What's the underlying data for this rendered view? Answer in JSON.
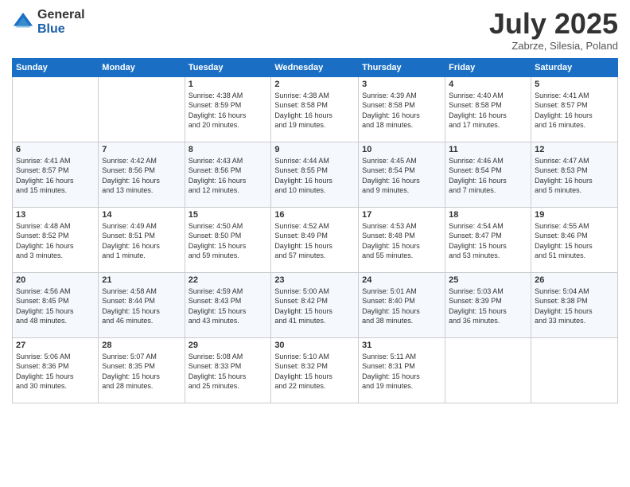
{
  "logo": {
    "general": "General",
    "blue": "Blue"
  },
  "title": "July 2025",
  "subtitle": "Zabrze, Silesia, Poland",
  "headers": [
    "Sunday",
    "Monday",
    "Tuesday",
    "Wednesday",
    "Thursday",
    "Friday",
    "Saturday"
  ],
  "weeks": [
    [
      {
        "day": "",
        "info": ""
      },
      {
        "day": "",
        "info": ""
      },
      {
        "day": "1",
        "info": "Sunrise: 4:38 AM\nSunset: 8:59 PM\nDaylight: 16 hours\nand 20 minutes."
      },
      {
        "day": "2",
        "info": "Sunrise: 4:38 AM\nSunset: 8:58 PM\nDaylight: 16 hours\nand 19 minutes."
      },
      {
        "day": "3",
        "info": "Sunrise: 4:39 AM\nSunset: 8:58 PM\nDaylight: 16 hours\nand 18 minutes."
      },
      {
        "day": "4",
        "info": "Sunrise: 4:40 AM\nSunset: 8:58 PM\nDaylight: 16 hours\nand 17 minutes."
      },
      {
        "day": "5",
        "info": "Sunrise: 4:41 AM\nSunset: 8:57 PM\nDaylight: 16 hours\nand 16 minutes."
      }
    ],
    [
      {
        "day": "6",
        "info": "Sunrise: 4:41 AM\nSunset: 8:57 PM\nDaylight: 16 hours\nand 15 minutes."
      },
      {
        "day": "7",
        "info": "Sunrise: 4:42 AM\nSunset: 8:56 PM\nDaylight: 16 hours\nand 13 minutes."
      },
      {
        "day": "8",
        "info": "Sunrise: 4:43 AM\nSunset: 8:56 PM\nDaylight: 16 hours\nand 12 minutes."
      },
      {
        "day": "9",
        "info": "Sunrise: 4:44 AM\nSunset: 8:55 PM\nDaylight: 16 hours\nand 10 minutes."
      },
      {
        "day": "10",
        "info": "Sunrise: 4:45 AM\nSunset: 8:54 PM\nDaylight: 16 hours\nand 9 minutes."
      },
      {
        "day": "11",
        "info": "Sunrise: 4:46 AM\nSunset: 8:54 PM\nDaylight: 16 hours\nand 7 minutes."
      },
      {
        "day": "12",
        "info": "Sunrise: 4:47 AM\nSunset: 8:53 PM\nDaylight: 16 hours\nand 5 minutes."
      }
    ],
    [
      {
        "day": "13",
        "info": "Sunrise: 4:48 AM\nSunset: 8:52 PM\nDaylight: 16 hours\nand 3 minutes."
      },
      {
        "day": "14",
        "info": "Sunrise: 4:49 AM\nSunset: 8:51 PM\nDaylight: 16 hours\nand 1 minute."
      },
      {
        "day": "15",
        "info": "Sunrise: 4:50 AM\nSunset: 8:50 PM\nDaylight: 15 hours\nand 59 minutes."
      },
      {
        "day": "16",
        "info": "Sunrise: 4:52 AM\nSunset: 8:49 PM\nDaylight: 15 hours\nand 57 minutes."
      },
      {
        "day": "17",
        "info": "Sunrise: 4:53 AM\nSunset: 8:48 PM\nDaylight: 15 hours\nand 55 minutes."
      },
      {
        "day": "18",
        "info": "Sunrise: 4:54 AM\nSunset: 8:47 PM\nDaylight: 15 hours\nand 53 minutes."
      },
      {
        "day": "19",
        "info": "Sunrise: 4:55 AM\nSunset: 8:46 PM\nDaylight: 15 hours\nand 51 minutes."
      }
    ],
    [
      {
        "day": "20",
        "info": "Sunrise: 4:56 AM\nSunset: 8:45 PM\nDaylight: 15 hours\nand 48 minutes."
      },
      {
        "day": "21",
        "info": "Sunrise: 4:58 AM\nSunset: 8:44 PM\nDaylight: 15 hours\nand 46 minutes."
      },
      {
        "day": "22",
        "info": "Sunrise: 4:59 AM\nSunset: 8:43 PM\nDaylight: 15 hours\nand 43 minutes."
      },
      {
        "day": "23",
        "info": "Sunrise: 5:00 AM\nSunset: 8:42 PM\nDaylight: 15 hours\nand 41 minutes."
      },
      {
        "day": "24",
        "info": "Sunrise: 5:01 AM\nSunset: 8:40 PM\nDaylight: 15 hours\nand 38 minutes."
      },
      {
        "day": "25",
        "info": "Sunrise: 5:03 AM\nSunset: 8:39 PM\nDaylight: 15 hours\nand 36 minutes."
      },
      {
        "day": "26",
        "info": "Sunrise: 5:04 AM\nSunset: 8:38 PM\nDaylight: 15 hours\nand 33 minutes."
      }
    ],
    [
      {
        "day": "27",
        "info": "Sunrise: 5:06 AM\nSunset: 8:36 PM\nDaylight: 15 hours\nand 30 minutes."
      },
      {
        "day": "28",
        "info": "Sunrise: 5:07 AM\nSunset: 8:35 PM\nDaylight: 15 hours\nand 28 minutes."
      },
      {
        "day": "29",
        "info": "Sunrise: 5:08 AM\nSunset: 8:33 PM\nDaylight: 15 hours\nand 25 minutes."
      },
      {
        "day": "30",
        "info": "Sunrise: 5:10 AM\nSunset: 8:32 PM\nDaylight: 15 hours\nand 22 minutes."
      },
      {
        "day": "31",
        "info": "Sunrise: 5:11 AM\nSunset: 8:31 PM\nDaylight: 15 hours\nand 19 minutes."
      },
      {
        "day": "",
        "info": ""
      },
      {
        "day": "",
        "info": ""
      }
    ]
  ]
}
